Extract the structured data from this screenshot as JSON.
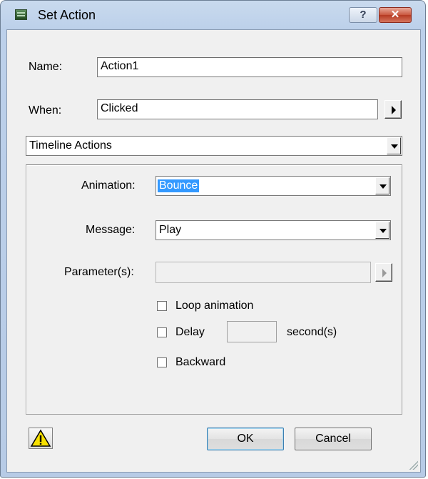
{
  "window": {
    "title": "Set Action",
    "help_label": "?",
    "close_label": "✕"
  },
  "name": {
    "label": "Name:",
    "value": "Action1"
  },
  "when": {
    "label": "When:",
    "value": "Clicked"
  },
  "category": {
    "value": "Timeline Actions"
  },
  "animation": {
    "label": "Animation:",
    "value": "Bounce"
  },
  "message": {
    "label": "Message:",
    "value": "Play"
  },
  "parameters": {
    "label": "Parameter(s):",
    "value": ""
  },
  "options": {
    "loop": {
      "label": "Loop animation",
      "checked": false
    },
    "delay": {
      "label": "Delay",
      "checked": false,
      "value": "",
      "unit": "second(s)"
    },
    "backward": {
      "label": "Backward",
      "checked": false
    }
  },
  "buttons": {
    "ok": "OK",
    "cancel": "Cancel"
  },
  "icons": {
    "app": "app-icon",
    "warning": "warning-icon"
  },
  "colors": {
    "selection": "#3399ff",
    "warning": "#f7e000"
  }
}
